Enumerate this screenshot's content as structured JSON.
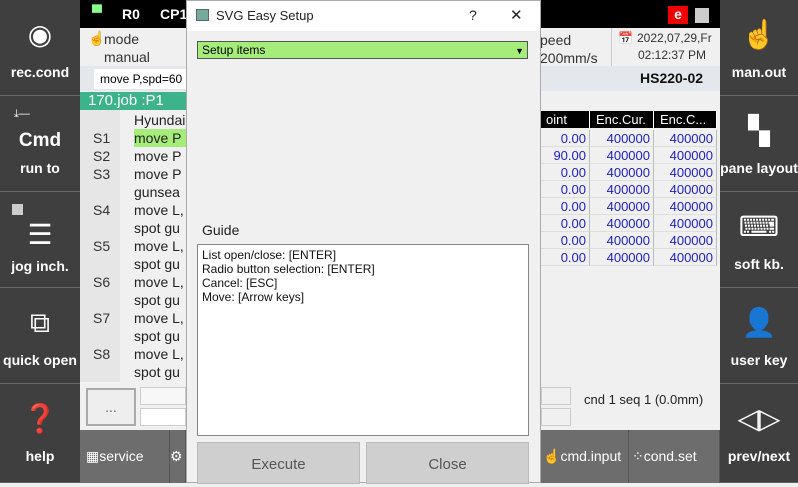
{
  "left_sidebar": [
    {
      "label": "rec.cond",
      "icon": "record-circle-icon"
    },
    {
      "label": "Cmd",
      "sub": "run to",
      "icon": "step-icon"
    },
    {
      "label": "jog inch.",
      "icon": "sliders-icon"
    },
    {
      "label": "quick open",
      "icon": "open-external-icon"
    },
    {
      "label": "help",
      "icon": "question-icon"
    }
  ],
  "right_sidebar": [
    {
      "label": "man.out",
      "icon": "hand-pointer-icon"
    },
    {
      "label": "pane layout",
      "icon": "layout-icon"
    },
    {
      "label": "soft kb.",
      "icon": "keyboard-icon"
    },
    {
      "label": "user key",
      "icon": "user-key-icon"
    },
    {
      "label": "prev/next",
      "icon": "prev-next-icon"
    }
  ],
  "topbar": {
    "robot": "R0",
    "cp": "CP1",
    "e_badge": "e"
  },
  "status": {
    "mode_label": "mode",
    "mode_value": "manual",
    "speed_label": "peed",
    "speed_value": "200mm/s",
    "date": "2022,07,29,Fr",
    "time": "02:12:37 PM",
    "model": "HS220-02",
    "command": "move P,spd=60"
  },
  "job": {
    "title": "170.job  :P1",
    "lines": [
      {
        "n": "",
        "t": "Hyundai"
      },
      {
        "n": "S1",
        "t": "move P"
      },
      {
        "n": "S2",
        "t": "move P"
      },
      {
        "n": "S3",
        "t": "move P"
      },
      {
        "n": "",
        "t": "gunsea"
      },
      {
        "n": "S4",
        "t": "move L,"
      },
      {
        "n": "",
        "t": "spot gu"
      },
      {
        "n": "S5",
        "t": "move L,"
      },
      {
        "n": "",
        "t": "spot gu"
      },
      {
        "n": "S6",
        "t": "move L,"
      },
      {
        "n": "",
        "t": "spot gu"
      },
      {
        "n": "S7",
        "t": "move L,"
      },
      {
        "n": "",
        "t": "spot gu"
      },
      {
        "n": "S8",
        "t": "move L,"
      },
      {
        "n": "",
        "t": "spot gu"
      }
    ]
  },
  "table": {
    "headers": [
      "oint",
      "Enc.Cur.",
      "Enc.C..."
    ],
    "rows": [
      [
        "0.00",
        "400000",
        "400000"
      ],
      [
        "90.00",
        "400000",
        "400000"
      ],
      [
        "0.00",
        "400000",
        "400000"
      ],
      [
        "0.00",
        "400000",
        "400000"
      ],
      [
        "0.00",
        "400000",
        "400000"
      ],
      [
        "0.00",
        "400000",
        "400000"
      ],
      [
        "0.00",
        "400000",
        "400000"
      ],
      [
        "0.00",
        "400000",
        "400000"
      ]
    ]
  },
  "cnd_seq": "cnd 1 seq 1 (0.0mm)",
  "more_button": "...",
  "bottom_bar": {
    "service": "service",
    "cmd_input": "cmd.input",
    "cond_set": "cond.set"
  },
  "dialog": {
    "title": "SVG Easy Setup",
    "help": "?",
    "close_x": "✕",
    "dropdown_value": "Setup items",
    "guide_label": "Guide",
    "guide_lines": [
      "List open/close: [ENTER]",
      "Radio button selection: [ENTER]",
      "Cancel: [ESC]",
      "Move: [Arrow keys]"
    ],
    "execute": "Execute",
    "close": "Close"
  }
}
